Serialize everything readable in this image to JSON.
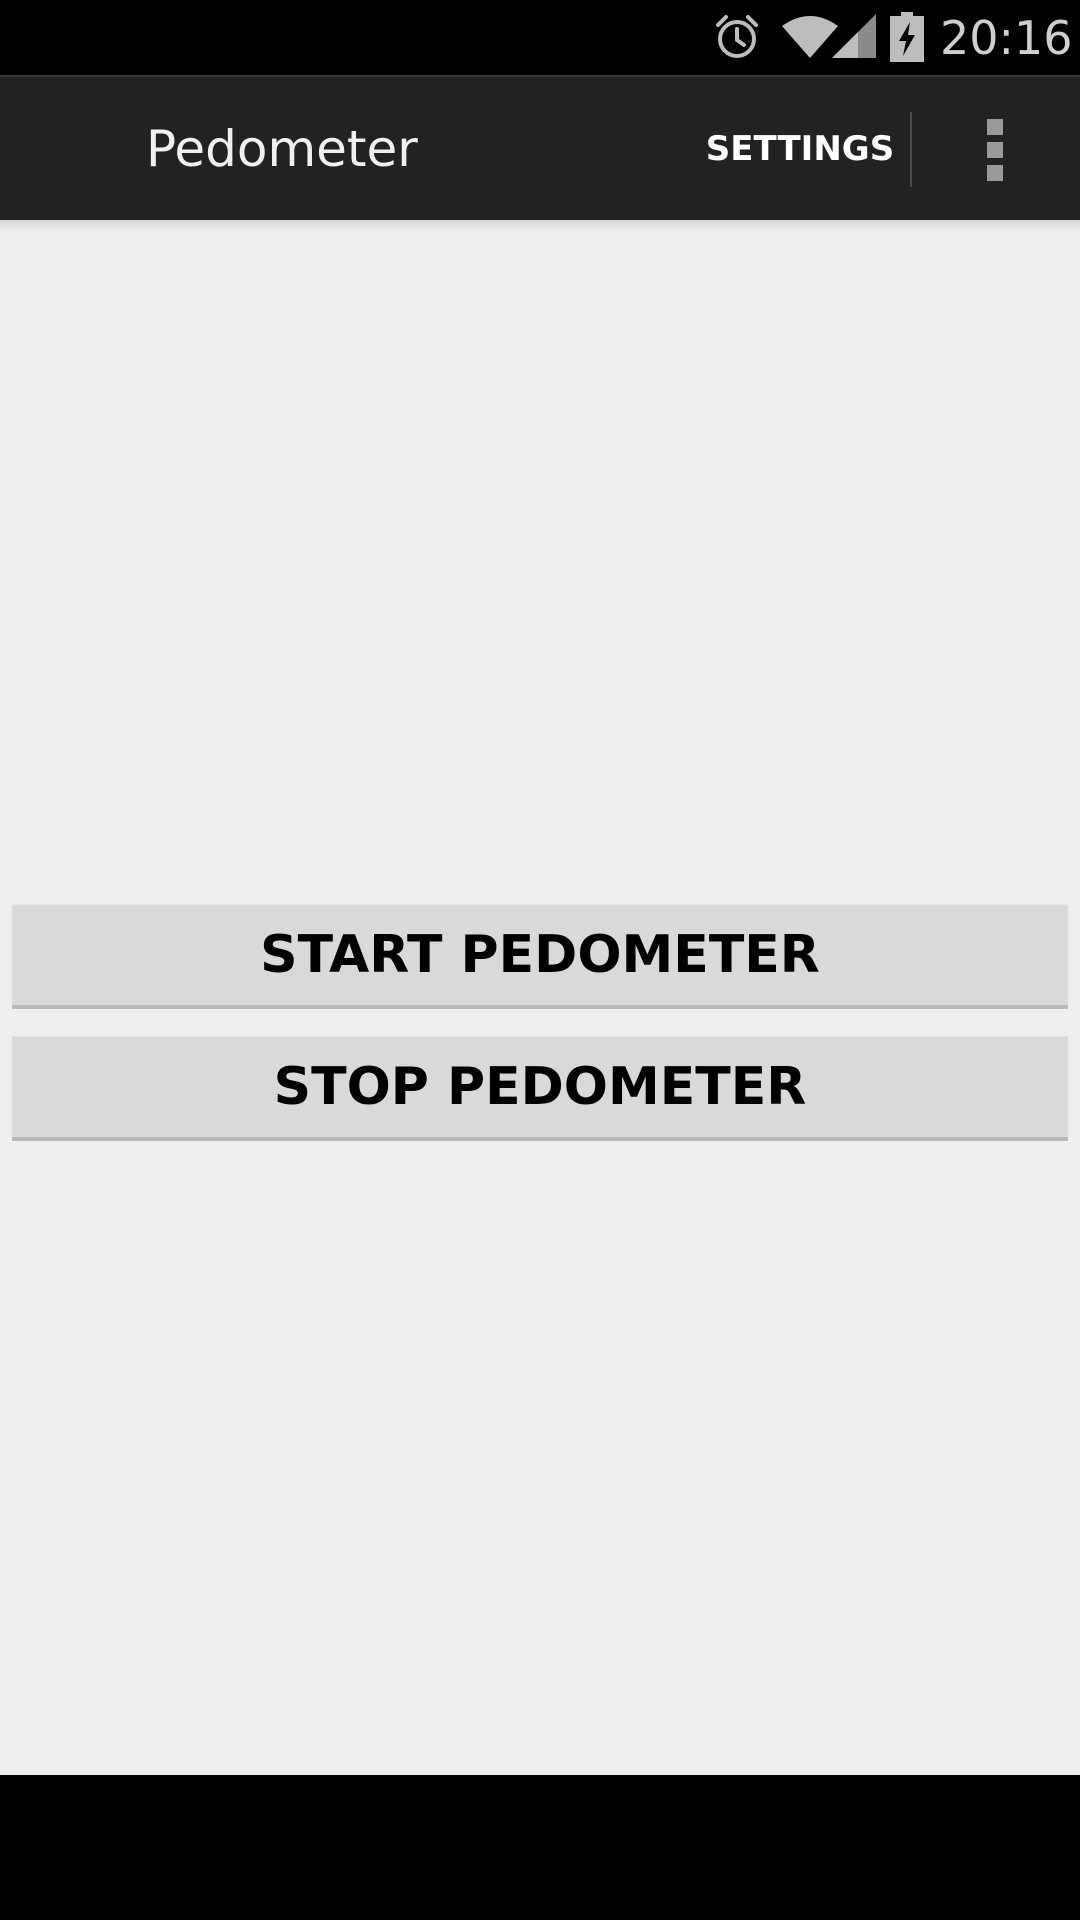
{
  "status_bar": {
    "time": "20:16",
    "icons": [
      "alarm-icon",
      "wifi-icon",
      "signal-icon",
      "battery-charging-icon"
    ]
  },
  "action_bar": {
    "title": "Pedometer",
    "settings_label": "SETTINGS",
    "overflow_icon": "overflow-menu-icon"
  },
  "main": {
    "start_button": "START PEDOMETER",
    "stop_button": "STOP PEDOMETER"
  },
  "colors": {
    "action_bar": "#222222",
    "content_background": "#eeeeee",
    "button_background": "#d8d9d9"
  }
}
